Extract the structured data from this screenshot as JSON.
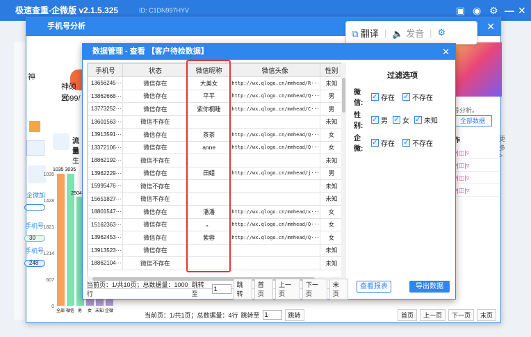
{
  "app": {
    "title": "极速查重-企微版 v2.1.5.325",
    "id_label": "ID: C1DN997HYV"
  },
  "analysis_window": {
    "title": "手机号分析",
    "left_labels": [
      "神",
      "神硕官",
      "2099/",
      "流量",
      "已生"
    ],
    "left_side_items": [
      "企微加",
      "手机号",
      "手机号"
    ],
    "small_badges": [
      "30",
      "248"
    ],
    "right_text": [
      "号分析。",
      "全部数据",
      "作",
      "更多>"
    ],
    "bottom_pager": {
      "info": "当前页：1/共1页；总数据量：4行",
      "jump_label": "跳转至",
      "jump_value": "1",
      "jump_btn": "跳转",
      "first": "首页",
      "prev": "上一页",
      "next": "下一页",
      "last": "末页"
    }
  },
  "translate_bar": {
    "translate": "翻译",
    "speak": "发音"
  },
  "chart_data": {
    "type": "bar",
    "categories": [
      "全部",
      "微信",
      "男",
      "女",
      "未知",
      "企微"
    ],
    "values": [
      3035,
      3035,
      2504,
      180,
      180,
      180
    ],
    "data_labels": [
      "1035 3035",
      "2504"
    ],
    "ytick_labels": [
      "1035",
      "1428",
      "1821",
      "1214",
      "607",
      "0"
    ],
    "xlabel": "",
    "ylabel": ""
  },
  "dialog": {
    "title": "数据管理 - 查看 【客户待检数据】",
    "columns": [
      "手机号",
      "状态",
      "微信昵称",
      "微信头像",
      "性别"
    ],
    "rows": [
      [
        "13656245···",
        "微信存在",
        "大美女",
        "http://wx.qlogo.cn/mmhead/R···",
        "未知"
      ],
      [
        "13862668···",
        "微信存在",
        "平平",
        "http://wx.qlogo.cn/mmhead/Q···",
        "男"
      ],
      [
        "13773252···",
        "微信存在",
        "紫你桐睡",
        "http://wx.qlogo.cn/mmhead/C···",
        "男"
      ],
      [
        "13601563···",
        "微信不存在",
        "",
        "",
        "未知"
      ],
      [
        "13913591···",
        "微信存在",
        "茶茶",
        "http://wx.qlogo.cn/mmhead/Q···",
        "女"
      ],
      [
        "13372106···",
        "微信存在",
        "anne",
        "http://wx.qlogo.cn/mmhead/Q···",
        "女"
      ],
      [
        "18862192···",
        "微信不存在",
        "",
        "",
        "未知"
      ],
      [
        "13962229···",
        "微信存在",
        "田蜡",
        "http://wx.qlogo.cn/mmhead/j···",
        "男"
      ],
      [
        "15995476···",
        "微信不存在",
        "",
        "",
        "未知"
      ],
      [
        "15651827···",
        "微信不存在",
        "",
        "",
        "未知"
      ],
      [
        "18801547···",
        "微信存在",
        "潘潘",
        "http://wx.qlogo.cn/mmhead/x···",
        "女"
      ],
      [
        "15162363···",
        "微信存在",
        "。",
        "http://wx.qlogo.cn/mmhead/Q···",
        "女"
      ],
      [
        "13962453···",
        "微信存在",
        "紫蓉",
        "http://wx.qlogo.cn/mmhead/Q···",
        "女"
      ],
      [
        "13913523···",
        "微信存在",
        "",
        "",
        "未知"
      ],
      [
        "18862104···",
        "微信不存在",
        "",
        "",
        "未知"
      ]
    ],
    "pager": {
      "info": "当前页：1/共10页；总数据量：1000行",
      "jump_label": "跳转至",
      "jump_value": "1",
      "jump_btn": "跳转",
      "first": "首页",
      "prev": "上一页",
      "next": "下一页",
      "last": "末页"
    },
    "filter": {
      "title": "过滤选项",
      "wechat_label": "微信:",
      "wechat_options": [
        "存在",
        "不存在"
      ],
      "gender_label": "性别:",
      "gender_options": [
        "男",
        "女",
        "未知"
      ],
      "corp_label": "企微:",
      "corp_options": [
        "存在",
        "不存在"
      ]
    },
    "view_report_btn": "查看报表",
    "export_btn": "导出数据"
  },
  "colors": {
    "accent": "#2f86ec",
    "highlight_box": "#e03a3a",
    "bar_orange": "#f4a460",
    "bar_green": "#7de3b3",
    "bar_purple": "#b39ddb"
  }
}
